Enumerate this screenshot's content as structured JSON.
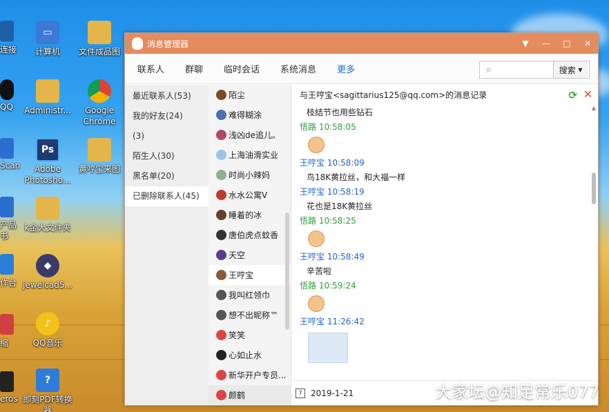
{
  "desktop": {
    "partial_icons": [
      {
        "label": "连接"
      },
      {
        "label": "QQ"
      },
      {
        "label": "Scan"
      },
      {
        "label": "产品"
      },
      {
        "label": "书"
      },
      {
        "label": "作台"
      },
      {
        "label": "缩"
      },
      {
        "label": "eros"
      }
    ],
    "icons": [
      {
        "label": "计算机",
        "icon": "computer-icon"
      },
      {
        "label": "文件成品图",
        "icon": "folder-icon"
      },
      {
        "label": "Administr...",
        "icon": "user-folder-icon"
      },
      {
        "label": "Google\nChrome",
        "icon": "chrome-icon"
      },
      {
        "label": "Adobe\nPhotosho...",
        "icon": "photoshop-icon"
      },
      {
        "label": "黄哼宝来图",
        "icon": "folder-icon"
      },
      {
        "label": "k金大文件夹",
        "icon": "folder-icon"
      },
      {
        "label": "jewelcad5...",
        "icon": "jewelcad-icon"
      },
      {
        "label": "QQ音乐",
        "icon": "qq-music-icon"
      },
      {
        "label": "即刻PDF转换\n器",
        "icon": "pdf-converter-icon"
      }
    ],
    "watermark": "大家坛@知足常乐077"
  },
  "window": {
    "title": "消息管理器",
    "controls": [
      "▼",
      "—",
      "□",
      "✕"
    ],
    "tabs": [
      {
        "label": "联系人",
        "active": false
      },
      {
        "label": "群聊",
        "active": false
      },
      {
        "label": "临时会话",
        "active": false
      },
      {
        "label": "系统消息",
        "active": false
      },
      {
        "label": "更多",
        "active": true
      }
    ],
    "search": {
      "placeholder": "",
      "button_label": "搜索"
    },
    "categories": [
      {
        "label": "最近联系人(53)"
      },
      {
        "label": "我的好友(24)"
      },
      {
        "label": "(3)"
      },
      {
        "label": "陌生人(30)"
      },
      {
        "label": "黑名单(20)"
      },
      {
        "label": "已删除联系人(45)",
        "selected": true
      }
    ],
    "contacts": [
      {
        "name": "陌尘",
        "color": "#7b4a2a"
      },
      {
        "name": "难得糊涂",
        "color": "#4a6fb3"
      },
      {
        "name": "浅凶de追儿。",
        "color": "#b3475e"
      },
      {
        "name": "上海油滑实业",
        "color": "#9bc3e3"
      },
      {
        "name": "时尚小辣妈",
        "color": "#8fb08a"
      },
      {
        "name": "水水公寓V",
        "color": "#c0392b"
      },
      {
        "name": "睡着的冰",
        "color": "#6b3d2e"
      },
      {
        "name": "唐伯虎点蚊香",
        "color": "#333333"
      },
      {
        "name": "天空",
        "color": "#5a3d8a"
      },
      {
        "name": "王哼宝",
        "color": "#8a5a3a",
        "selected": true
      },
      {
        "name": "我叫红领巾",
        "color": "#555555"
      },
      {
        "name": "想不出昵称™",
        "color": "#555555"
      },
      {
        "name": "笑笑",
        "color": "#d44"
      },
      {
        "name": "心如止水",
        "color": "#222222"
      },
      {
        "name": "新华开户专员...",
        "color": "#d44"
      },
      {
        "name": "颜鹤",
        "color": "#d44",
        "highlight": true
      }
    ],
    "chat": {
      "header": "与王哼宝<sagittarius125@qq.com>的消息记录",
      "messages": [
        {
          "kind": "text",
          "text": "枝结节也用些钻石"
        },
        {
          "kind": "meta",
          "sender": "悟路",
          "time": "10:58:05",
          "color": "green"
        },
        {
          "kind": "emoji",
          "icon": "ok-hand-emoji"
        },
        {
          "kind": "meta",
          "sender": "王哼宝",
          "time": "10:58:09",
          "color": "blue"
        },
        {
          "kind": "text",
          "text": "鸟18K黄拉丝，和大福一样"
        },
        {
          "kind": "meta",
          "sender": "王哼宝",
          "time": "10:58:19",
          "color": "blue"
        },
        {
          "kind": "text",
          "text": "花也是18K黄拉丝"
        },
        {
          "kind": "meta",
          "sender": "悟路",
          "time": "10:58:25",
          "color": "green"
        },
        {
          "kind": "emoji",
          "icon": "ok-hand-emoji"
        },
        {
          "kind": "meta",
          "sender": "王哼宝",
          "time": "10:58:49",
          "color": "blue"
        },
        {
          "kind": "text",
          "text": "辛苦啦"
        },
        {
          "kind": "meta",
          "sender": "悟路",
          "time": "10:59:24",
          "color": "green"
        },
        {
          "kind": "emoji",
          "icon": "ok-hand-emoji"
        },
        {
          "kind": "meta",
          "sender": "王哼宝",
          "time": "11:26:42",
          "color": "blue"
        },
        {
          "kind": "image",
          "icon": "image-placeholder-icon"
        }
      ]
    },
    "date": "2019-1-21"
  }
}
